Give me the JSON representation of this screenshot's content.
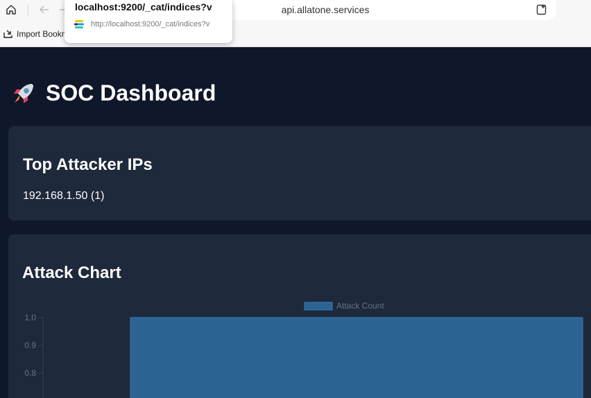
{
  "browser": {
    "address": "api.allatone.services",
    "bookmark_label": "Import Bookm",
    "suggestion": {
      "title": "localhost:9200/_cat/indices?v",
      "url": "http://localhost:9200/_cat/indices?v"
    }
  },
  "dashboard": {
    "title": "SOC Dashboard",
    "title_icon": "rocket-icon",
    "top_attackers": {
      "heading": "Top Attacker IPs",
      "items": [
        "192.168.1.50 (1)"
      ]
    },
    "attack_chart": {
      "heading": "Attack Chart"
    }
  },
  "colors": {
    "page_bg": "#0f172a",
    "card_bg": "#1e293b",
    "bar_fill": "#2b6392",
    "bar_stroke": "#3a7bbf"
  },
  "chart_data": {
    "type": "bar",
    "series": [
      {
        "name": "Attack Count",
        "values": [
          1
        ]
      }
    ],
    "y_ticks": [
      "1.0",
      "0.9",
      "0.8"
    ],
    "ylim": [
      0,
      1
    ],
    "legend": "top-center"
  }
}
